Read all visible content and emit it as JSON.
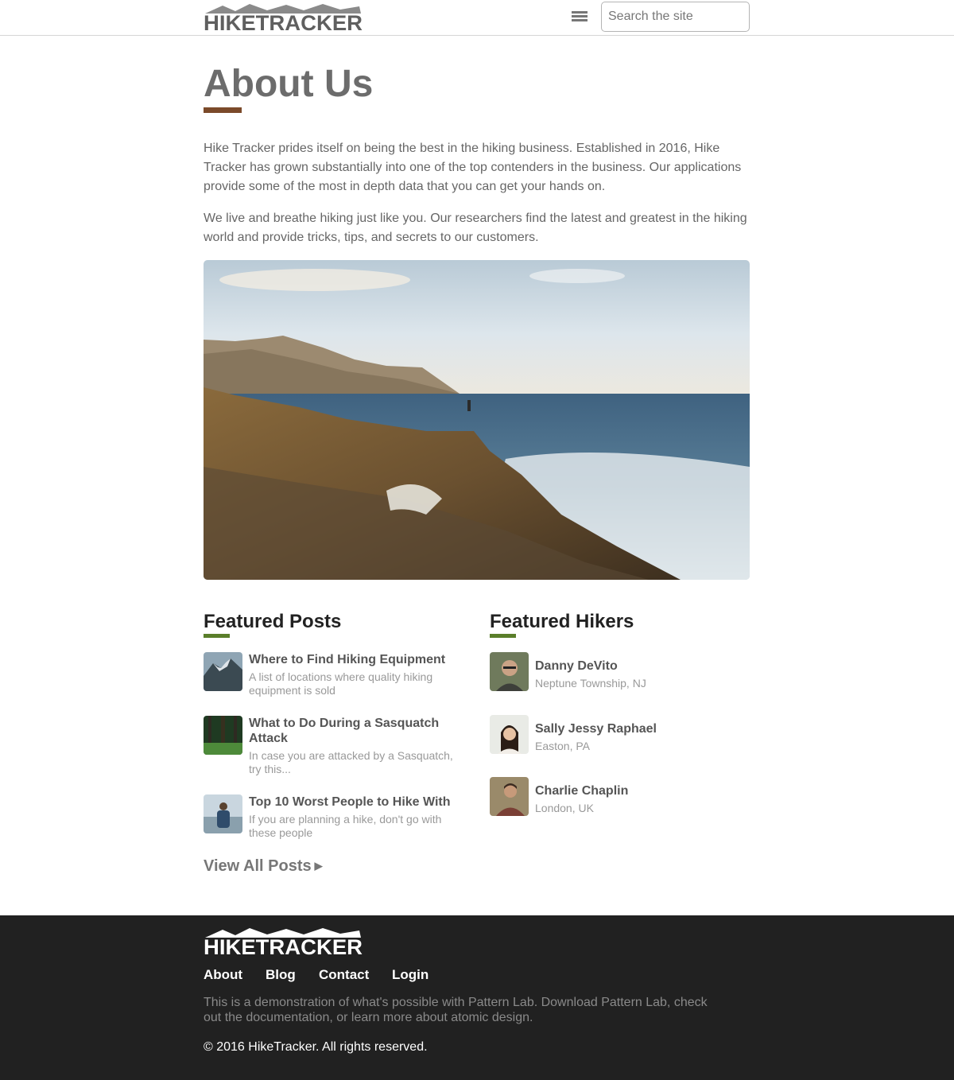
{
  "header": {
    "logo_text": "HIKETRACKER",
    "search": {
      "placeholder": "Search the site",
      "value": ""
    }
  },
  "main": {
    "title": "About Us",
    "intro": [
      "Hike Tracker prides itself on being the best in the hiking business. Established in 2016, Hike Tracker has grown substantially into one of the top contenders in the business. Our applications provide some of the most in depth data that you can get your hands on.",
      "We live and breathe hiking just like you. Our researchers find the latest and greatest in the hiking world and provide tricks, tips, and secrets to our customers."
    ]
  },
  "featured_posts": {
    "heading": "Featured Posts",
    "items": [
      {
        "title": "Where to Find Hiking Equipment",
        "desc": "A list of locations where quality hiking equipment is sold"
      },
      {
        "title": "What to Do During a Sasquatch Attack",
        "desc": "In case you are attacked by a Sasquatch, try this..."
      },
      {
        "title": "Top 10 Worst People to Hike With",
        "desc": "If you are planning a hike, don't go with these people"
      }
    ],
    "view_all": "View All Posts"
  },
  "featured_hikers": {
    "heading": "Featured Hikers",
    "items": [
      {
        "name": "Danny DeVito",
        "location": "Neptune Township, NJ"
      },
      {
        "name": "Sally Jessy Raphael",
        "location": "Easton, PA"
      },
      {
        "name": "Charlie Chaplin",
        "location": "London, UK"
      }
    ]
  },
  "footer": {
    "logo_text": "HIKETRACKER",
    "nav": [
      "About",
      "Blog",
      "Contact",
      "Login"
    ],
    "text": "This is a demonstration of what's possible with Pattern Lab. Download Pattern Lab, check out the documentation, or learn more about atomic design.",
    "copyright": "© 2016 HikeTracker. All rights reserved."
  },
  "icons": {
    "menu": "hamburger-menu-icon",
    "view_all_arrow": "triangle-right-icon"
  },
  "colors": {
    "title_accent": "#7b4a2a",
    "section_accent": "#5a7e2a",
    "footer_bg": "#212121"
  }
}
